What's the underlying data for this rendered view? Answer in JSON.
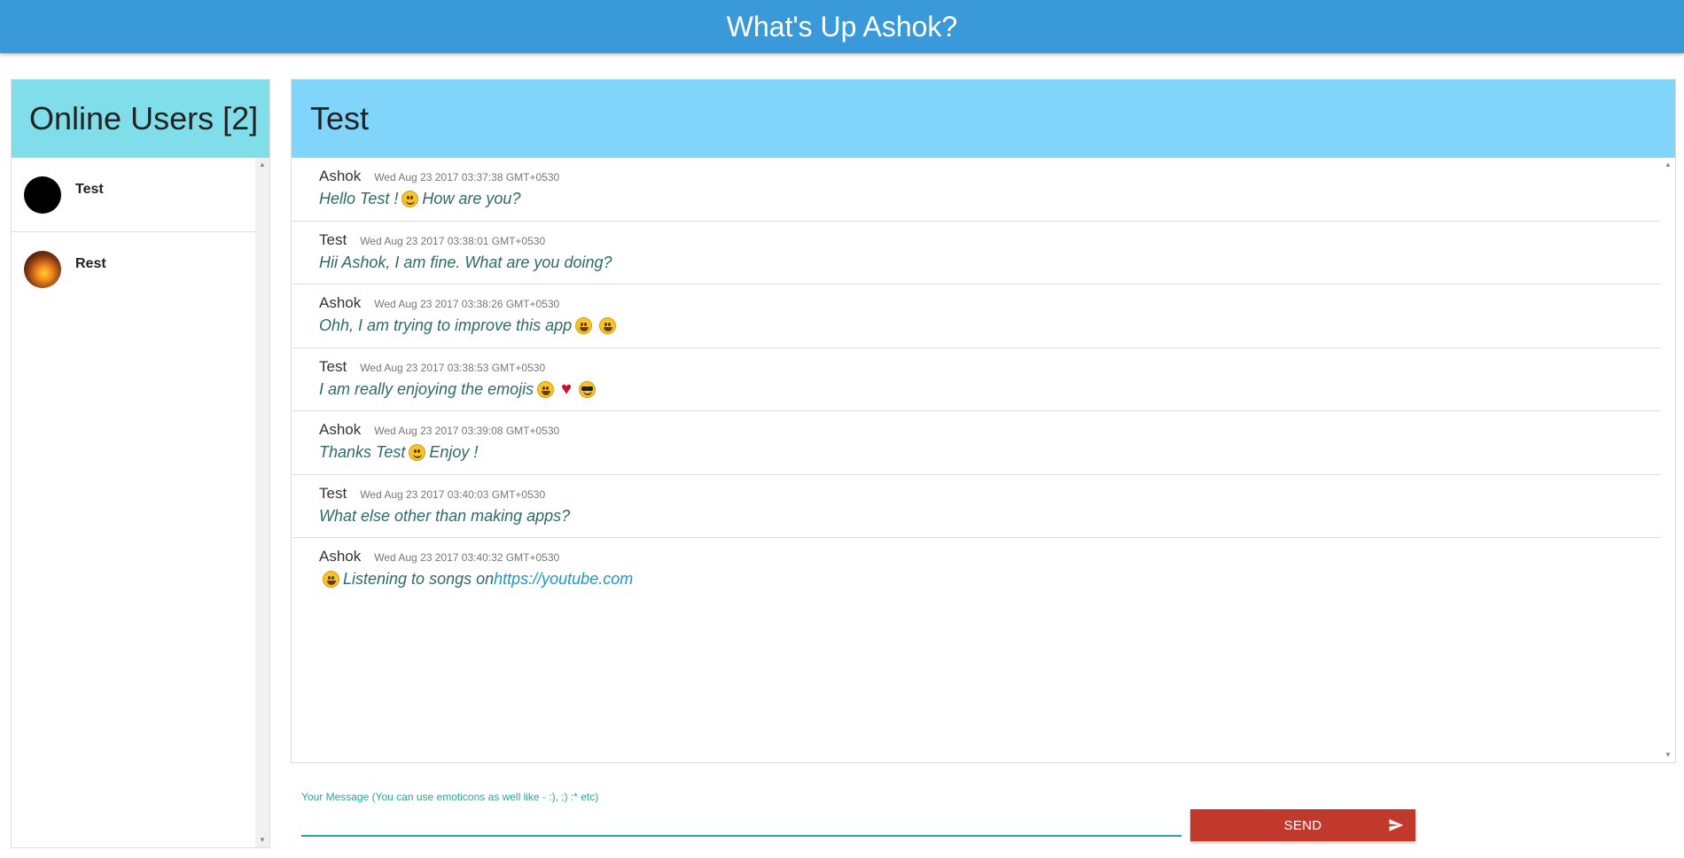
{
  "app": {
    "title": "What's Up Ashok?"
  },
  "users_panel": {
    "title": "Online Users [2]",
    "users": [
      {
        "name": "Test",
        "avatar": "black-avatar"
      },
      {
        "name": "Rest",
        "avatar": "sunset-avatar"
      }
    ]
  },
  "chat": {
    "title": "Test",
    "messages": [
      {
        "author": "Ashok",
        "time": "Wed Aug 23 2017 03:37:38 GMT+0530",
        "parts": [
          "Hello Test !",
          "smile-emoji",
          "How are you?"
        ]
      },
      {
        "author": "Test",
        "time": "Wed Aug 23 2017 03:38:01 GMT+0530",
        "parts": [
          "Hii Ashok, I am fine. What are you doing?"
        ]
      },
      {
        "author": "Ashok",
        "time": "Wed Aug 23 2017 03:38:26 GMT+0530",
        "parts": [
          "Ohh, I am trying to improve this app",
          "grin-emoji",
          "grin-emoji"
        ]
      },
      {
        "author": "Test",
        "time": "Wed Aug 23 2017 03:38:53 GMT+0530",
        "parts": [
          "I am really enjoying the emojis",
          "grin-emoji",
          "heart-emoji",
          "sunglasses-emoji"
        ]
      },
      {
        "author": "Ashok",
        "time": "Wed Aug 23 2017 03:39:08 GMT+0530",
        "parts": [
          "Thanks Test",
          "smile-emoji",
          "Enjoy !"
        ]
      },
      {
        "author": "Test",
        "time": "Wed Aug 23 2017 03:40:03 GMT+0530",
        "parts": [
          "What else other than making apps?"
        ]
      },
      {
        "author": "Ashok",
        "time": "Wed Aug 23 2017 03:40:32 GMT+0530",
        "parts": [
          "grin-emoji",
          "Listening to songs on",
          "link:https://youtube.com"
        ]
      }
    ]
  },
  "composer": {
    "label": "Your Message (You can use emoticons as well like - :), ;) :* etc)",
    "value": "",
    "send_label": "SEND"
  },
  "colors": {
    "topbar": "#3a99d9",
    "users_header": "#80deea",
    "chat_header": "#81d4fa",
    "accent": "#26a69a",
    "send_button": "#c0392b"
  }
}
